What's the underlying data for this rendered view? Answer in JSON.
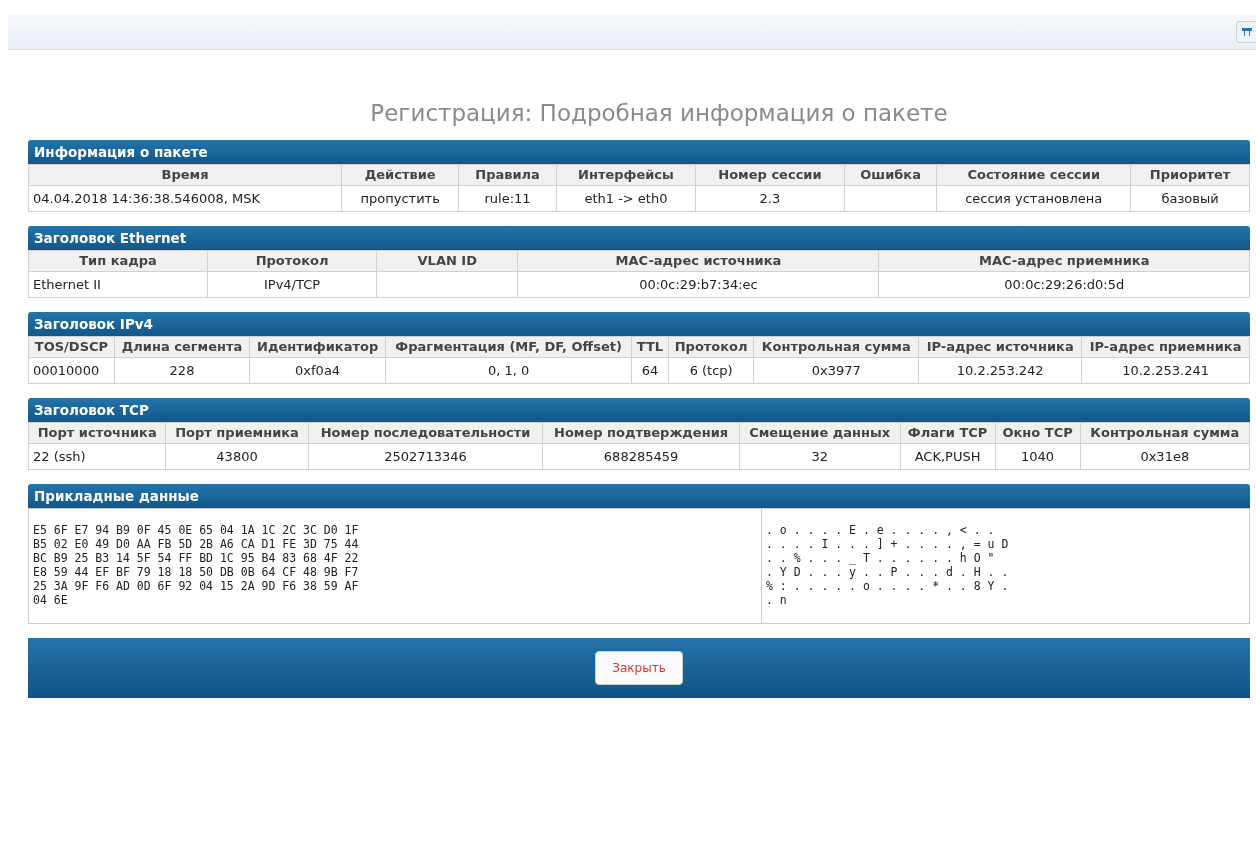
{
  "title": "Регистрация: Подробная информация о пакете",
  "sections": [
    {
      "kind": "table",
      "title": "Информация о пакете",
      "columns": [
        "Время",
        "Действие",
        "Правила",
        "Интерфейсы",
        "Номер сессии",
        "Ошибка",
        "Состояние сессии",
        "Приоритет"
      ],
      "rows": [
        [
          "04.04.2018 14:36:38.546008, MSK",
          "пропустить",
          "rule:11",
          "eth1 -> eth0",
          "2.3",
          "",
          "сессия установлена",
          "базовый"
        ]
      ]
    },
    {
      "kind": "table",
      "title": "Заголовок Ethernet",
      "columns": [
        "Тип кадра",
        "Протокол",
        "VLAN ID",
        "MAC-адрес источника",
        "MAC-адрес приемника"
      ],
      "rows": [
        [
          "Ethernet II",
          "IPv4/TCP",
          "",
          "00:0c:29:b7:34:ec",
          "00:0c:29:26:d0:5d"
        ]
      ]
    },
    {
      "kind": "table",
      "title": "Заголовок IPv4",
      "columns": [
        "TOS/DSCP",
        "Длина сегмента",
        "Идентификатор",
        "Фрагментация (MF, DF, Offset)",
        "TTL",
        "Протокол",
        "Контрольная сумма",
        "IP-адрес источника",
        "IP-адрес приемника"
      ],
      "rows": [
        [
          "00010000",
          "228",
          "0xf0a4",
          "0, 1, 0",
          "64",
          "6 (tcp)",
          "0x3977",
          "10.2.253.242",
          "10.2.253.241"
        ]
      ]
    },
    {
      "kind": "table",
      "title": "Заголовок TCP",
      "columns": [
        "Порт источника",
        "Порт приемника",
        "Номер последовательности",
        "Номер подтверждения",
        "Смещение данных",
        "Флаги TCP",
        "Окно TCP",
        "Контрольная сумма"
      ],
      "rows": [
        [
          "22 (ssh)",
          "43800",
          "2502713346",
          "688285459",
          "32",
          "ACK,PUSH",
          "1040",
          "0x31e8"
        ]
      ]
    },
    {
      "kind": "hex",
      "title": "Прикладные данные",
      "hex": [
        "E5 6F E7 94 B9 0F 45 0E 65 04 1A 1C 2C 3C D0 1F",
        "B5 02 E0 49 D0 AA FB 5D 2B A6 CA D1 FE 3D 75 44",
        "BC B9 25 B3 14 5F 54 FF BD 1C 95 B4 83 68 4F 22",
        "E8 59 44 EF BF 79 18 18 50 DB 0B 64 CF 48 9B F7",
        "25 3A 9F F6 AD 0D 6F 92 04 15 2A 9D F6 38 59 AF",
        "04 6E"
      ],
      "ascii": [
        ". o . . . . E . e . . . . , < . .",
        ". . . . I . . . ] + . . . . , = u D",
        ". . % . . . _ T . . . . . . h O \"",
        ". Y D . . . y . . P . . . d . H . .",
        "% : . . . . . o . . . . * . . 8 Y .",
        ". n"
      ]
    }
  ],
  "close_button": "Закрыть"
}
